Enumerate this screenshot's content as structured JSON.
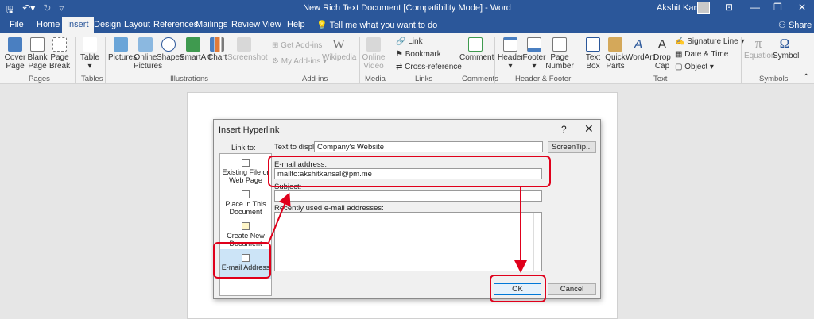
{
  "window": {
    "title": "New Rich Text Document [Compatibility Mode] - Word",
    "user": "Akshit Kansal"
  },
  "tabs": [
    "File",
    "Home",
    "Insert",
    "Design",
    "Layout",
    "References",
    "Mailings",
    "Review",
    "View",
    "Help"
  ],
  "active_tab": "Insert",
  "tellme": "Tell me what you want to do",
  "share": "Share",
  "ribbon": {
    "pages": {
      "cover_page": "Cover Page",
      "blank_page": "Blank Page",
      "page_break": "Page Break",
      "group": "Pages"
    },
    "tables": {
      "table": "Table",
      "group": "Tables"
    },
    "illustrations": {
      "pictures": "Pictures",
      "online_pictures": "Online Pictures",
      "shapes": "Shapes",
      "smartart": "SmartArt",
      "chart": "Chart",
      "screenshot": "Screenshot",
      "group": "Illustrations"
    },
    "addins": {
      "get_addins": "Get Add-ins",
      "my_addins": "My Add-ins",
      "wikipedia": "Wikipedia",
      "group": "Add-ins"
    },
    "media": {
      "online_video": "Online Video",
      "group": "Media"
    },
    "links": {
      "link": "Link",
      "bookmark": "Bookmark",
      "cross_reference": "Cross-reference",
      "group": "Links"
    },
    "comments": {
      "comment": "Comment",
      "group": "Comments"
    },
    "header_footer": {
      "header": "Header",
      "footer": "Footer",
      "page_number": "Page Number",
      "group": "Header & Footer"
    },
    "text": {
      "text_box": "Text Box",
      "quick_parts": "Quick Parts",
      "wordart": "WordArt",
      "drop_cap": "Drop Cap",
      "signature_line": "Signature Line",
      "date_time": "Date & Time",
      "object": "Object",
      "group": "Text"
    },
    "symbols": {
      "equation": "Equation",
      "symbol": "Symbol",
      "group": "Symbols"
    }
  },
  "dialog": {
    "title": "Insert Hyperlink",
    "help": "?",
    "close": "✕",
    "link_to_label": "Link to:",
    "link_to": {
      "existing": "Existing File or Web Page",
      "place": "Place in This Document",
      "create_new": "Create New Document",
      "email": "E-mail Address"
    },
    "text_to_display_label": "Text to display:",
    "text_to_display": "Company's Website",
    "screentip": "ScreenTip...",
    "email_label": "E-mail address:",
    "email_value": "mailto:akshitkansal@pm.me",
    "subject_label": "Subject:",
    "subject_value": "",
    "recent_label": "Recently used e-mail addresses:",
    "ok": "OK",
    "cancel": "Cancel"
  },
  "colors": {
    "word_blue": "#2b579a",
    "annotation_red": "#e0001b",
    "selected": "#cce4f7"
  }
}
